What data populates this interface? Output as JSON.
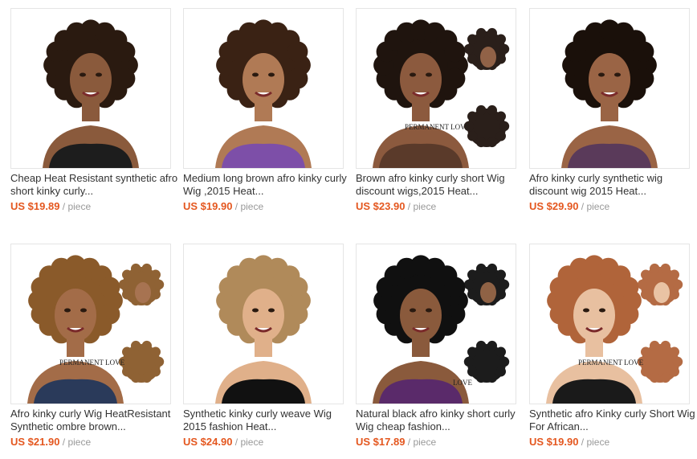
{
  "products": [
    {
      "title": "Cheap Heat Resistant synthetic afro short kinky curly...",
      "price": "US $19.89",
      "unit": "/ piece",
      "hair": "#2a1a10",
      "skin": "#8a5a3c",
      "top": "#1d1d1d",
      "watermark": ""
    },
    {
      "title": "Medium long brown afro kinky curly Wig ,2015 Heat...",
      "price": "US $19.90",
      "unit": "/ piece",
      "hair": "#3a2214",
      "skin": "#b07a55",
      "top": "#7d4fa8",
      "watermark": ""
    },
    {
      "title": "Brown afro kinky curly short Wig discount wigs,2015 Heat...",
      "price": "US $23.90",
      "unit": "/ piece",
      "hair": "#1f140e",
      "skin": "#8c5a3e",
      "top": "#5a3a2a",
      "watermark": "PERMANENT LOVE"
    },
    {
      "title": "Afro kinky curly synthetic wig discount wig 2015 Heat...",
      "price": "US $29.90",
      "unit": "/ piece",
      "hair": "#1a100a",
      "skin": "#9a6445",
      "top": "#5a3a5a",
      "watermark": ""
    },
    {
      "title": "Afro kinky curly Wig HeatResistant Synthetic ombre brown...",
      "price": "US $21.90",
      "unit": "/ piece",
      "hair": "#8a5a2a",
      "skin": "#a36c48",
      "top": "#2a3a5a",
      "watermark": "PERMANENT LOVE"
    },
    {
      "title": "Synthetic kinky curly weave Wig 2015 fashion Heat...",
      "price": "US $24.90",
      "unit": "/ piece",
      "hair": "#b08a5a",
      "skin": "#e0b08a",
      "top": "#111111",
      "watermark": ""
    },
    {
      "title": "Natural black afro kinky short curly Wig cheap fashion...",
      "price": "US $17.89",
      "unit": "/ piece",
      "hair": "#101010",
      "skin": "#8a5a3c",
      "top": "#5a2a6a",
      "watermark": "LOVE"
    },
    {
      "title": "Synthetic afro Kinky curly Short Wig For African...",
      "price": "US $19.90",
      "unit": "/ piece",
      "hair": "#b0643a",
      "skin": "#e8c0a0",
      "top": "#1a1a1a",
      "watermark": "PERMANENT LOVE"
    }
  ]
}
